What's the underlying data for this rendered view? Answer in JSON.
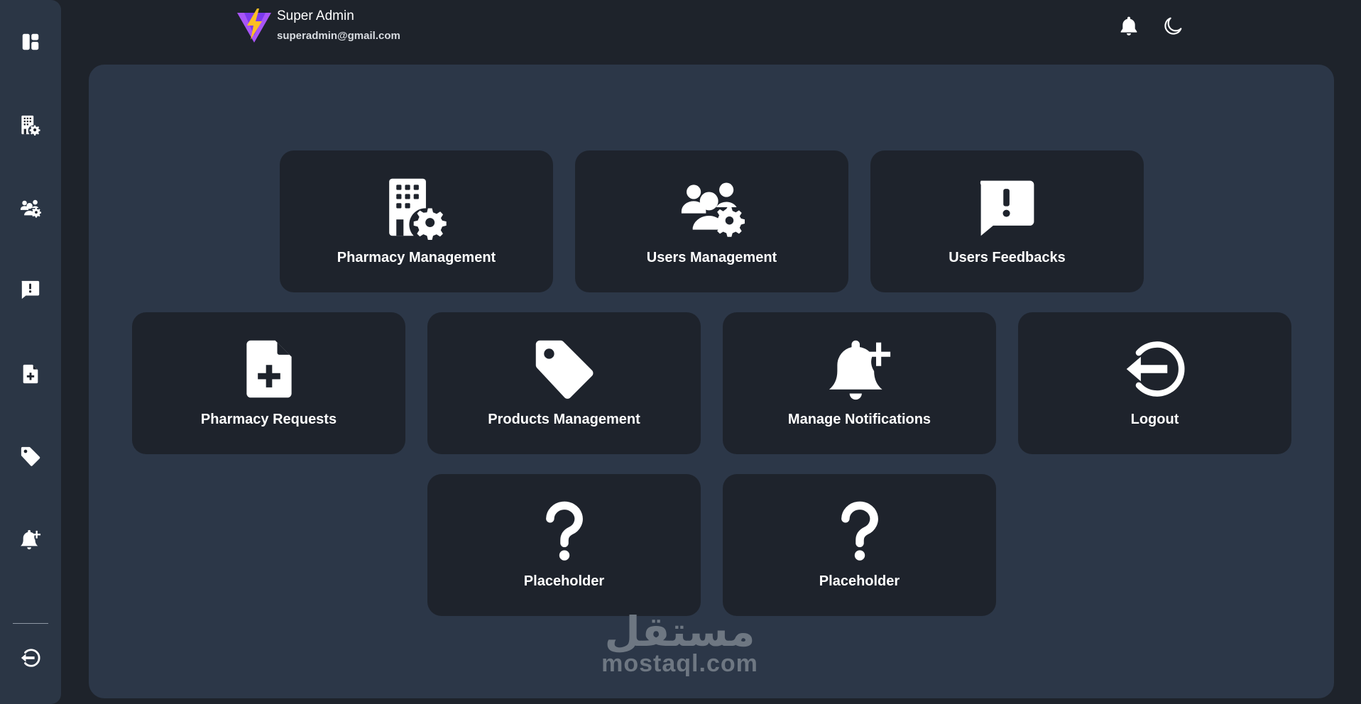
{
  "colors": {
    "page_bg": "#1e232b",
    "sidebar_bg": "#2b3645",
    "content_bg": "#2c3748",
    "card_bg": "#1e232c",
    "text": "#ffffff",
    "logo_bolt": "#fbbf24",
    "logo_triangle": "#a855f7"
  },
  "sidebar": {
    "items": [
      {
        "icon": "dashboard-icon"
      },
      {
        "icon": "building-gear-icon"
      },
      {
        "icon": "users-gear-icon"
      },
      {
        "icon": "feedback-icon"
      },
      {
        "icon": "file-plus-icon"
      },
      {
        "icon": "tag-icon"
      },
      {
        "icon": "bell-plus-icon"
      },
      {
        "icon": "logout-icon"
      }
    ]
  },
  "header": {
    "user_name": "Super Admin",
    "user_email": "superadmin@gmail.com",
    "notifications_icon": "bell-icon",
    "theme_icon": "moon-icon"
  },
  "cards": [
    {
      "label": "Pharmacy Management",
      "icon": "building-gear-icon"
    },
    {
      "label": "Users Management",
      "icon": "users-gear-icon"
    },
    {
      "label": "Users Feedbacks",
      "icon": "feedback-icon"
    },
    {
      "label": "Pharmacy Requests",
      "icon": "file-plus-icon"
    },
    {
      "label": "Products Management",
      "icon": "tag-icon"
    },
    {
      "label": "Manage Notifications",
      "icon": "bell-plus-icon"
    },
    {
      "label": "Logout",
      "icon": "logout-icon"
    },
    {
      "label": "Placeholder",
      "icon": "question-icon"
    },
    {
      "label": "Placeholder",
      "icon": "question-icon"
    }
  ],
  "watermark": {
    "arabic": "مستقل",
    "latin": "mostaql.com"
  }
}
